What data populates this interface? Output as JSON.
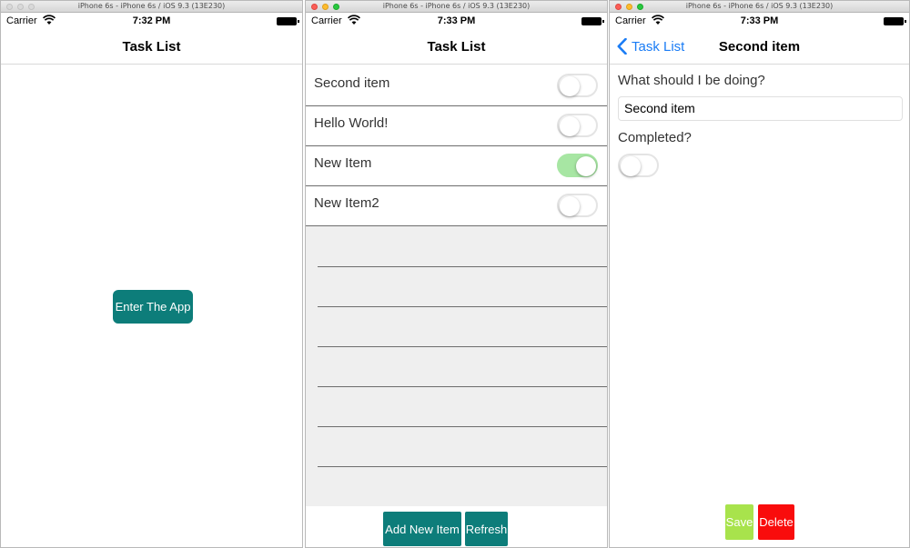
{
  "window_title": "iPhone 6s - iPhone 6s / iOS 9.3 (13E230)",
  "carrier": "Carrier",
  "screens": {
    "home": {
      "time": "7:32 PM",
      "title": "Task List",
      "enter_button": "Enter The App"
    },
    "list": {
      "time": "7:33 PM",
      "title": "Task List",
      "items": [
        {
          "label": "Second item",
          "completed": false
        },
        {
          "label": "Hello World!",
          "completed": false
        },
        {
          "label": "New Item",
          "completed": true
        },
        {
          "label": "New Item2",
          "completed": false
        }
      ],
      "add_button": "Add New Item",
      "refresh_button": "Refresh"
    },
    "detail": {
      "time": "7:33 PM",
      "back_label": "Task List",
      "title": "Second item",
      "question_label": "What should I be doing?",
      "field_value": "Second item",
      "completed_label": "Completed?",
      "completed": false,
      "save_button": "Save",
      "delete_button": "Delete"
    }
  },
  "colors": {
    "accent_teal": "#0d7d7a",
    "ios_blue": "#1a7cf5",
    "switch_on": "#a7e6a3",
    "save_green": "#a8e34c",
    "delete_red": "#f90c0c"
  }
}
